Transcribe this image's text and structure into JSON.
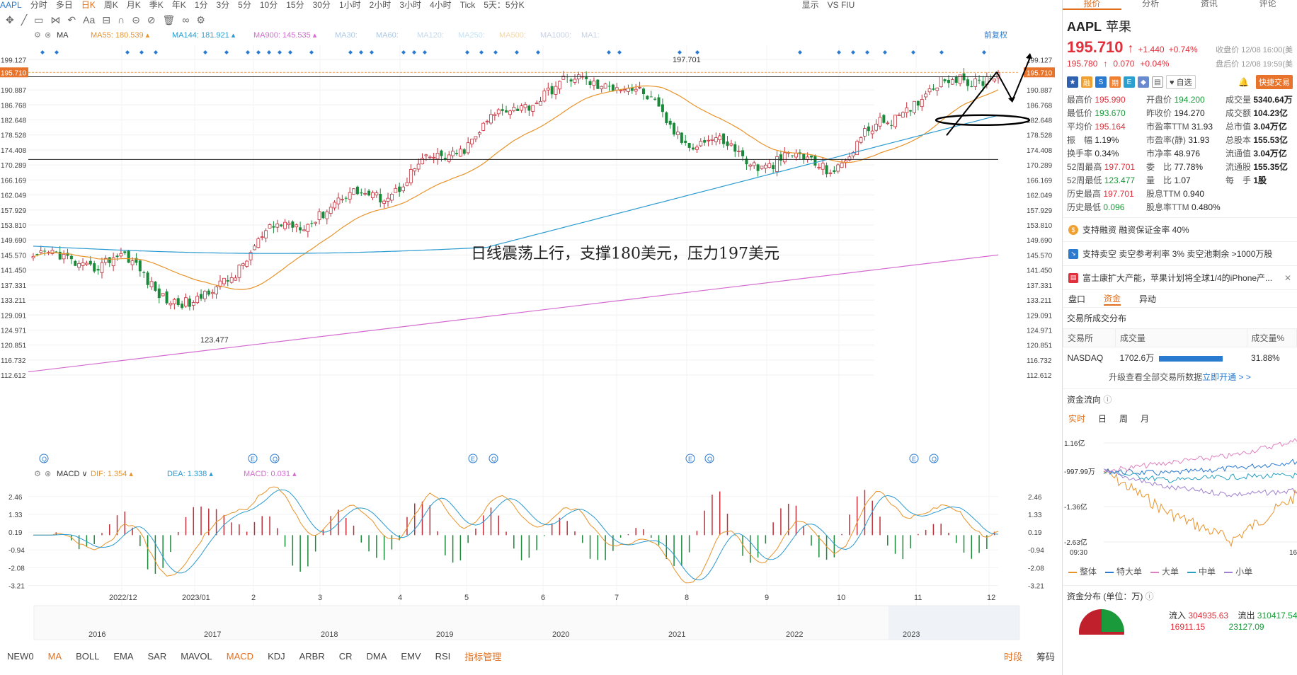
{
  "topbar": {
    "symbol": "AAPL",
    "periods": [
      "分时",
      "多日",
      "日K",
      "周K",
      "月K",
      "季K",
      "年K",
      "1分",
      "3分",
      "5分",
      "10分",
      "15分",
      "30分",
      "1小时",
      "2小时",
      "3小时",
      "4小时",
      "Tick",
      "5天：5分K"
    ],
    "active_period": "日K",
    "right_items": [
      "显示",
      "VS FIU"
    ]
  },
  "ma_bar": {
    "label": "MA",
    "items": [
      {
        "name": "MA55:",
        "value": "180.539",
        "color": "#e8932a"
      },
      {
        "name": "MA144:",
        "value": "181.921",
        "color": "#2a9ad0"
      },
      {
        "name": "MA900:",
        "value": "145.535",
        "color": "#d46ad0"
      },
      {
        "name": "MA30:",
        "value": "",
        "color": "#b0c8e0"
      },
      {
        "name": "MA60:",
        "value": "",
        "color": "#b0c8e0"
      },
      {
        "name": "MA120:",
        "value": "",
        "color": "#c8d8e8"
      },
      {
        "name": "MA250:",
        "value": "",
        "color": "#c8e0f0"
      },
      {
        "name": "MA500:",
        "value": "",
        "color": "#f0d8b0"
      },
      {
        "name": "MA1000:",
        "value": "",
        "color": "#c8d0e0"
      },
      {
        "name": "MA1:",
        "value": "",
        "color": "#c8d0e0"
      }
    ],
    "adjust": "前复权"
  },
  "macd_bar": {
    "label": "MACD",
    "items": [
      {
        "name": "DIF:",
        "value": "1.354",
        "color": "#e8932a"
      },
      {
        "name": "DEA:",
        "value": "1.338",
        "color": "#2a9ad0"
      },
      {
        "name": "MACD:",
        "value": "0.031",
        "color": "#d46ad0"
      }
    ]
  },
  "price_axis": [
    "199.127",
    "195.710",
    "190.887",
    "186.768",
    "182.648",
    "178.528",
    "174.408",
    "170.289",
    "166.169",
    "162.049",
    "157.929",
    "153.810",
    "149.690",
    "145.570",
    "141.450",
    "137.331",
    "133.211",
    "129.091",
    "124.971",
    "120.851",
    "116.732",
    "112.612"
  ],
  "macd_axis": [
    "2.46",
    "1.33",
    "0.19",
    "-0.94",
    "-2.08",
    "-3.21"
  ],
  "time_axis": [
    "2022/12",
    "2023/01",
    "2",
    "3",
    "4",
    "5",
    "6",
    "7",
    "8",
    "9",
    "10",
    "11",
    "12"
  ],
  "overview_years": [
    "2016",
    "2017",
    "2018",
    "2019",
    "2020",
    "2021",
    "2022",
    "2023"
  ],
  "chart_data": {
    "type": "candlestick",
    "title": "",
    "annotation": "日线震荡上行，支撑180美元，压力197美元",
    "high_label": "197.701",
    "low_label": "123.477",
    "last_price": "195.710",
    "support_level": 180,
    "resistance_level": 197,
    "ylim": [
      110.5,
      201.2
    ],
    "x": [
      "2022/12",
      "2023/01",
      "2",
      "3",
      "4",
      "5",
      "6",
      "7",
      "8",
      "9",
      "10",
      "11",
      "12"
    ],
    "close_by_month": [
      144,
      130,
      148,
      158,
      165,
      177,
      191,
      194,
      178,
      171,
      171,
      189,
      196
    ],
    "macd_ylim": [
      -3.5,
      2.9
    ]
  },
  "indicators": {
    "items": [
      "NEW0",
      "MA",
      "BOLL",
      "EMA",
      "SAR",
      "MAVOL",
      "MACD",
      "KDJ",
      "ARBR",
      "CR",
      "DMA",
      "EMV",
      "RSI"
    ],
    "active": [
      "MA",
      "MACD"
    ],
    "manager": "指标管理",
    "right": [
      "时段",
      "筹码"
    ]
  },
  "right": {
    "tabs": [
      "报价",
      "分析",
      "资讯",
      "评论"
    ],
    "symbol": "AAPL",
    "name_cn": "苹果",
    "price": "195.710",
    "change": "+1.440",
    "change_pct": "+0.74%",
    "close_label": "收盘价 12/08 16:00(美",
    "after_price": "195.780",
    "after_change": "0.070",
    "after_pct": "+0.04%",
    "after_label": "盘后价 12/08 19:59(美",
    "fav": "自选",
    "quick": "快捷交易",
    "quote": [
      [
        "最高价",
        "195.990",
        "开盘价",
        "194.200",
        "成交量",
        "5340.64万"
      ],
      [
        "最低价",
        "193.670",
        "昨收价",
        "194.270",
        "成交额",
        "104.23亿"
      ],
      [
        "平均价",
        "195.164",
        "市盈率TTM",
        "31.93",
        "总市值",
        "3.04万亿"
      ],
      [
        "振　幅",
        "1.19%",
        "市盈率(静)",
        "31.93",
        "总股本",
        "155.53亿"
      ],
      [
        "换手率",
        "0.34%",
        "市净率",
        "48.976",
        "流通值",
        "3.04万亿"
      ],
      [
        "52周最高",
        "197.701",
        "委　比",
        "77.78%",
        "流通股",
        "155.35亿"
      ],
      [
        "52周最低",
        "123.477",
        "量　比",
        "1.07",
        "每　手",
        "1股"
      ],
      [
        "历史最高",
        "197.701",
        "股息TTM",
        "0.940",
        "",
        ""
      ],
      [
        "历史最低",
        "0.096",
        "股息率TTM",
        "0.480%",
        "",
        ""
      ]
    ],
    "notices": [
      "支持融资 融资保证金率 40%",
      "支持卖空 卖空参考利率 3% 卖空池剩余 >1000万股",
      "富士康扩大产能，苹果计划将全球1/4的iPhone产..."
    ],
    "subtabs": [
      "盘口",
      "资金",
      "异动"
    ],
    "exchange_title": "交易所成交分布",
    "exchange_headers": [
      "交易所",
      "成交量",
      "成交量%"
    ],
    "exchange_row": {
      "name": "NASDAQ",
      "vol": "1702.6万",
      "pct": "31.88%"
    },
    "upgrade_text": "升级查看全部交易所数据",
    "upgrade_link": "立即开通 > >",
    "flow_title": "资金流向",
    "flow_tabs": [
      "实时",
      "日",
      "周",
      "月"
    ],
    "flow_axis": [
      "1.16亿",
      "-997.99万",
      "-1.36亿",
      "-2.63亿"
    ],
    "flow_time": [
      "09:30",
      "16"
    ],
    "flow_legend": [
      {
        "name": "整体",
        "color": "#e8932a"
      },
      {
        "name": "特大单",
        "color": "#2a7ad0"
      },
      {
        "name": "大单",
        "color": "#e080c0"
      },
      {
        "name": "中单",
        "color": "#2aa0c0"
      },
      {
        "name": "小单",
        "color": "#a080d0"
      }
    ],
    "dist_title": "资金分布 (单位：万)",
    "inflow_label": "流入",
    "inflow": "304935.63",
    "outflow_label": "流出",
    "outflow": "310417.54",
    "inflow2": "16911.15",
    "outflow2": "23127.09"
  }
}
